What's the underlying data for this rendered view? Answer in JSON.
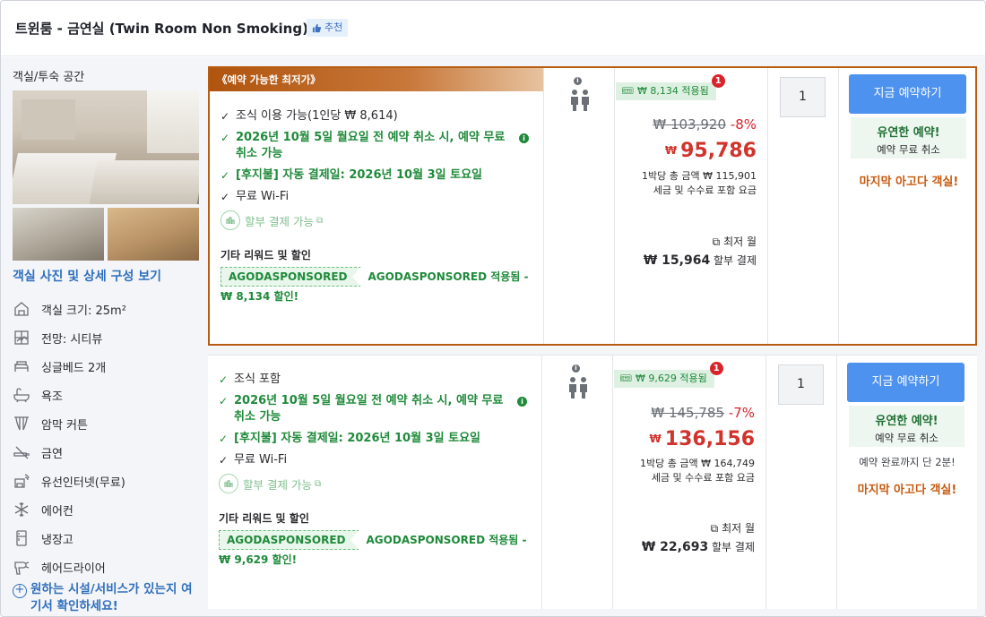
{
  "header": {
    "room_title": "트윈룸 - 금연실 (Twin Room Non Smoking)",
    "recommend_label": "추천"
  },
  "left_panel": {
    "section_title": "객실/투숙 공간",
    "photo_link": "객실 사진 및 상세 구성 보기",
    "amenities": [
      {
        "icon": "room-size-icon",
        "label": "객실 크기: 25m²"
      },
      {
        "icon": "view-icon",
        "label": "전망: 시티뷰"
      },
      {
        "icon": "bed-icon",
        "label": "싱글베드 2개"
      },
      {
        "icon": "bathtub-icon",
        "label": "욕조"
      },
      {
        "icon": "blackout-curtain-icon",
        "label": "암막 커튼"
      },
      {
        "icon": "no-smoking-icon",
        "label": "금연"
      },
      {
        "icon": "wired-internet-icon",
        "label": "유선인터넷(무료)"
      },
      {
        "icon": "air-conditioner-icon",
        "label": "에어컨"
      },
      {
        "icon": "refrigerator-icon",
        "label": "냉장고"
      },
      {
        "icon": "hair-dryer-icon",
        "label": "헤어드라이어"
      }
    ],
    "facility_link": "원하는 시설/서비스가 있는지 여기서 확인하세요!"
  },
  "offers": [
    {
      "best_badge": "《예약 가능한 최저가》",
      "conditions": [
        {
          "type": "plain",
          "text": "조식 이용 가능(1인당 ₩ 8,614)"
        },
        {
          "type": "green",
          "text": "2026년 10월 5일 월요일 전 예약 취소 시, 예약 무료 취소 가능",
          "info": true
        },
        {
          "type": "green",
          "text": "[후지불] 자동 결제일: 2026년 10월 3일 토요일"
        },
        {
          "type": "plain",
          "text": "무료 Wi-Fi"
        }
      ],
      "partial_payment": "할부 결제 가능",
      "other_title": "기타 리워드 및 할인",
      "coupon_code": "AGODASPONSORED",
      "coupon_text": "AGODASPONSORED 적용됨 - ₩ 8,134 할인!",
      "promo_label": "₩ 8,134 적용됨",
      "promo_count": "1",
      "original_price": "₩ 103,920",
      "discount": "-8%",
      "currency": "₩",
      "final_price": "95,786",
      "total_line1": "1박당 총 금액 ₩ 115,901",
      "total_line2": "세금 및 수수료 포함 요금",
      "monthly_label": "최저 월",
      "monthly_amount": "₩ 15,964",
      "monthly_suffix": "할부 결제",
      "quantity": "1",
      "book_label": "지금 예약하기",
      "flex_title": "유연한 예약!",
      "flex_sub": "예약 무료 취소",
      "sold_soon": "",
      "last_room": "마지막 아고다 객실!"
    },
    {
      "best_badge": "",
      "conditions": [
        {
          "type": "plain-green-check",
          "text": "조식 포함"
        },
        {
          "type": "green",
          "text": "2026년 10월 5일 월요일 전 예약 취소 시, 예약 무료 취소 가능",
          "info": true
        },
        {
          "type": "green",
          "text": "[후지불] 자동 결제일: 2026년 10월 3일 토요일"
        },
        {
          "type": "plain",
          "text": "무료 Wi-Fi"
        }
      ],
      "partial_payment": "할부 결제 가능",
      "other_title": "기타 리워드 및 할인",
      "coupon_code": "AGODASPONSORED",
      "coupon_text": "AGODASPONSORED 적용됨 - ₩ 9,629 할인!",
      "promo_label": "₩ 9,629 적용됨",
      "promo_count": "1",
      "original_price": "₩ 145,785",
      "discount": "-7%",
      "currency": "₩",
      "final_price": "136,156",
      "total_line1": "1박당 총 금액 ₩ 164,749",
      "total_line2": "세금 및 수수료 포함 요금",
      "monthly_label": "최저 월",
      "monthly_amount": "₩ 22,693",
      "monthly_suffix": "할부 결제",
      "quantity": "1",
      "book_label": "지금 예약하기",
      "flex_title": "유연한 예약!",
      "flex_sub": "예약 무료 취소",
      "sold_soon": "예약 완료까지 단 2분!",
      "last_room": "마지막 아고다 객실!"
    }
  ],
  "colors": {
    "accent_blue": "#4e92f0",
    "link_blue": "#2f6fbd",
    "green": "#1f8a3a",
    "price_red": "#d0342c",
    "highlight_border": "#b85c12"
  }
}
